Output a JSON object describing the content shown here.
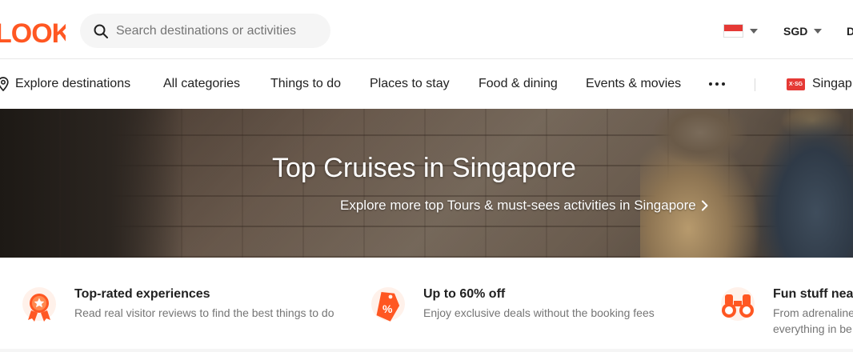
{
  "header": {
    "logo_text": "LOOK",
    "search": {
      "placeholder": "Search destinations or activities"
    },
    "country_flag": "singapore-flag-icon",
    "currency": "SGD",
    "cut_label": "D"
  },
  "nav": {
    "items": [
      {
        "label": "Explore destinations",
        "icon": "location-pin-icon"
      },
      {
        "label": "All categories"
      },
      {
        "label": "Things to do"
      },
      {
        "label": "Places to stay"
      },
      {
        "label": "Food & dining"
      },
      {
        "label": "Events & movies"
      }
    ],
    "more_icon": "more-dots-icon",
    "promo": {
      "badge": "X·SG",
      "label": "Singap"
    }
  },
  "hero": {
    "title": "Top Cruises in Singapore",
    "link": "Explore more top Tours & must-sees activities in Singapore"
  },
  "features": [
    {
      "icon": "award-ribbon-icon",
      "title": "Top-rated experiences",
      "subtitle": "Read real visitor reviews to find the best things to do"
    },
    {
      "icon": "discount-tag-icon",
      "title": "Up to 60% off",
      "subtitle": "Enjoy exclusive deals without the booking fees"
    },
    {
      "icon": "binoculars-icon",
      "title": "Fun stuff nea",
      "subtitle": "From adrenaline everything in be"
    }
  ],
  "colors": {
    "brand": "#ff5722",
    "text": "#212121",
    "muted": "#757575"
  }
}
